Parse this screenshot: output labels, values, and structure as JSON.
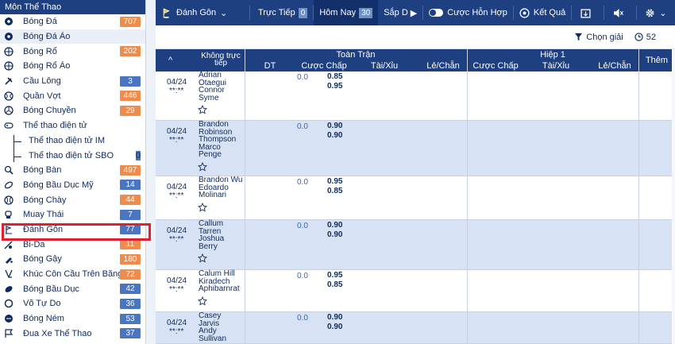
{
  "sidebar": {
    "title": "Môn Thể Thao",
    "items": [
      {
        "label": "Bóng Đá",
        "badge": "707",
        "badge_color": "orange",
        "icon": "soccer-ball-icon"
      },
      {
        "label": "Bóng Đá Ảo",
        "badge": "",
        "icon": "soccer-ball-icon"
      },
      {
        "label": "Bóng Rổ",
        "badge": "202",
        "badge_color": "orange",
        "icon": "basketball-icon"
      },
      {
        "label": "Bóng Rổ Ảo",
        "badge": "",
        "icon": "basketball-icon"
      },
      {
        "label": "Cầu Lông",
        "badge": "3",
        "badge_color": "blue",
        "icon": "shuttlecock-icon"
      },
      {
        "label": "Quần Vợt",
        "badge": "446",
        "badge_color": "orange",
        "icon": "tennis-ball-icon"
      },
      {
        "label": "Bóng Chuyền",
        "badge": "29",
        "badge_color": "orange",
        "icon": "volleyball-icon"
      },
      {
        "label": "Thể thao điện tử",
        "badge": "",
        "icon": "gamepad-icon"
      }
    ],
    "subitems": [
      {
        "label": "Thể thao điện tử IM",
        "badge": ""
      },
      {
        "label": "Thể thao điện tử SBO",
        "badge": "0",
        "badge_color": "blue"
      }
    ],
    "items2": [
      {
        "label": "Bóng Bàn",
        "badge": "497",
        "badge_color": "orange",
        "icon": "table-tennis-icon"
      },
      {
        "label": "Bóng Bầu Dục Mỹ",
        "badge": "14",
        "badge_color": "blue",
        "icon": "american-football-icon"
      },
      {
        "label": "Bóng Chày",
        "badge": "44",
        "badge_color": "orange",
        "icon": "baseball-icon"
      },
      {
        "label": "Muay Thái",
        "badge": "7",
        "badge_color": "blue",
        "icon": "boxing-glove-icon"
      },
      {
        "label": "Đánh Gôn",
        "badge": "77",
        "badge_color": "blue",
        "icon": "golf-icon"
      },
      {
        "label": "Bi-Da",
        "badge": "11",
        "badge_color": "orange",
        "icon": "billiards-icon"
      },
      {
        "label": "Bóng Gậy",
        "badge": "180",
        "badge_color": "orange",
        "icon": "cricket-icon"
      },
      {
        "label": "Khúc Côn Cầu Trên Băng",
        "badge": "72",
        "badge_color": "orange",
        "icon": "hockey-icon"
      },
      {
        "label": "Bóng Bầu Dục",
        "badge": "42",
        "badge_color": "blue",
        "icon": "rugby-icon"
      },
      {
        "label": "Võ Tự Do",
        "badge": "36",
        "badge_color": "blue",
        "icon": "mma-icon"
      },
      {
        "label": "Bóng Ném",
        "badge": "53",
        "badge_color": "blue",
        "icon": "handball-icon"
      },
      {
        "label": "Đua Xe Thể Thao",
        "badge": "37",
        "badge_color": "blue",
        "icon": "racing-flag-icon"
      }
    ]
  },
  "topbar": {
    "sport": "Đánh Gôn",
    "live_label": "Trực Tiếp",
    "live_count": "0",
    "today_label": "Hôm Nay",
    "today_count": "30",
    "early_label": "Sắp D",
    "combo_label": "Cược Hỗn Hợp",
    "results_label": "Kết Quả"
  },
  "filterbar": {
    "choose_league": "Chọn giải",
    "count": "52"
  },
  "table": {
    "col_no_live": "Không trực tiếp",
    "group_full": "Toàn Trận",
    "group_half": "Hiệp 1",
    "col_dt": "DT",
    "col_hdp": "Cược Chấp",
    "col_ou": "Tài/Xỉu",
    "col_oe": "Lẻ/Chẵn",
    "col_hdp2": "Cược Chấp",
    "col_ou2": "Tài/Xỉu",
    "col_oe2": "Lẻ/Chẵn",
    "col_more": "Thêm"
  },
  "rows": [
    {
      "date": "04/24",
      "time": "**:**",
      "names": [
        "Adrian",
        "Otaegui",
        "Connor",
        "Syme"
      ],
      "hdp": "0.0",
      "odds1": "0.85",
      "odds2": "0.95"
    },
    {
      "date": "04/24",
      "time": "**:**",
      "names": [
        "Brandon",
        "Robinson",
        "Thompson",
        "Marco",
        "Penge"
      ],
      "hdp": "0.0",
      "odds1": "0.90",
      "odds2": "0.90"
    },
    {
      "date": "04/24",
      "time": "**:**",
      "names": [
        "Brandon Wu",
        "Edoardo",
        "Molinari"
      ],
      "hdp": "0.0",
      "odds1": "0.95",
      "odds2": "0.85"
    },
    {
      "date": "04/24",
      "time": "**:**",
      "names": [
        "Callum",
        "Tarren",
        "Joshua",
        "Berry"
      ],
      "hdp": "0.0",
      "odds1": "0.90",
      "odds2": "0.90"
    },
    {
      "date": "04/24",
      "time": "**:**",
      "names": [
        "Calum Hill",
        "Kiradech",
        "Aphibarnrat"
      ],
      "hdp": "0.0",
      "odds1": "0.95",
      "odds2": "0.85"
    },
    {
      "date": "04/24",
      "time": "**:**",
      "names": [
        "Casey",
        "Jarvis",
        "Andy",
        "Sullivan"
      ],
      "hdp": "0.0",
      "odds1": "0.90",
      "odds2": "0.90"
    }
  ]
}
